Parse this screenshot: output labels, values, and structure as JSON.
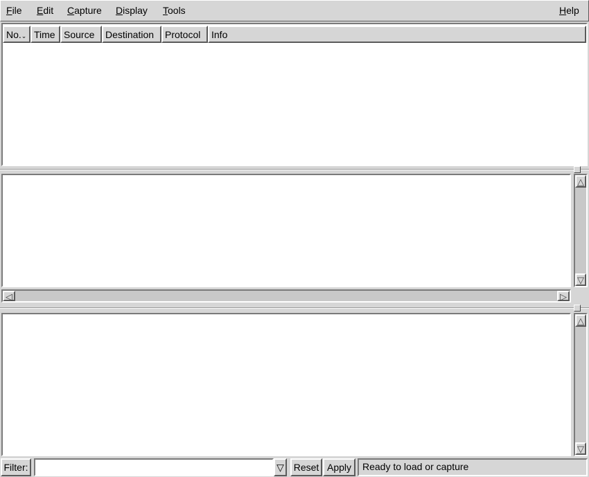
{
  "menubar": {
    "items": [
      {
        "label": "File",
        "mnemonic": "F",
        "rest": "ile"
      },
      {
        "label": "Edit",
        "mnemonic": "E",
        "rest": "dit"
      },
      {
        "label": "Capture",
        "mnemonic": "C",
        "rest": "apture"
      },
      {
        "label": "Display",
        "mnemonic": "D",
        "rest": "isplay"
      },
      {
        "label": "Tools",
        "mnemonic": "T",
        "rest": "ools"
      }
    ],
    "help": {
      "label": "Help",
      "mnemonic": "H",
      "rest": "elp"
    }
  },
  "packet_list": {
    "columns": [
      "No.",
      "Time",
      "Source",
      "Destination",
      "Protocol",
      "Info"
    ],
    "sort_indicator": "⌄"
  },
  "filter": {
    "label": "Filter:",
    "value": "",
    "dropdown_icon": "▽"
  },
  "buttons": {
    "reset": "Reset",
    "apply": "Apply"
  },
  "status": "Ready to load or capture",
  "colors": {
    "background": "#d6d6d6",
    "pane": "#ffffff"
  }
}
